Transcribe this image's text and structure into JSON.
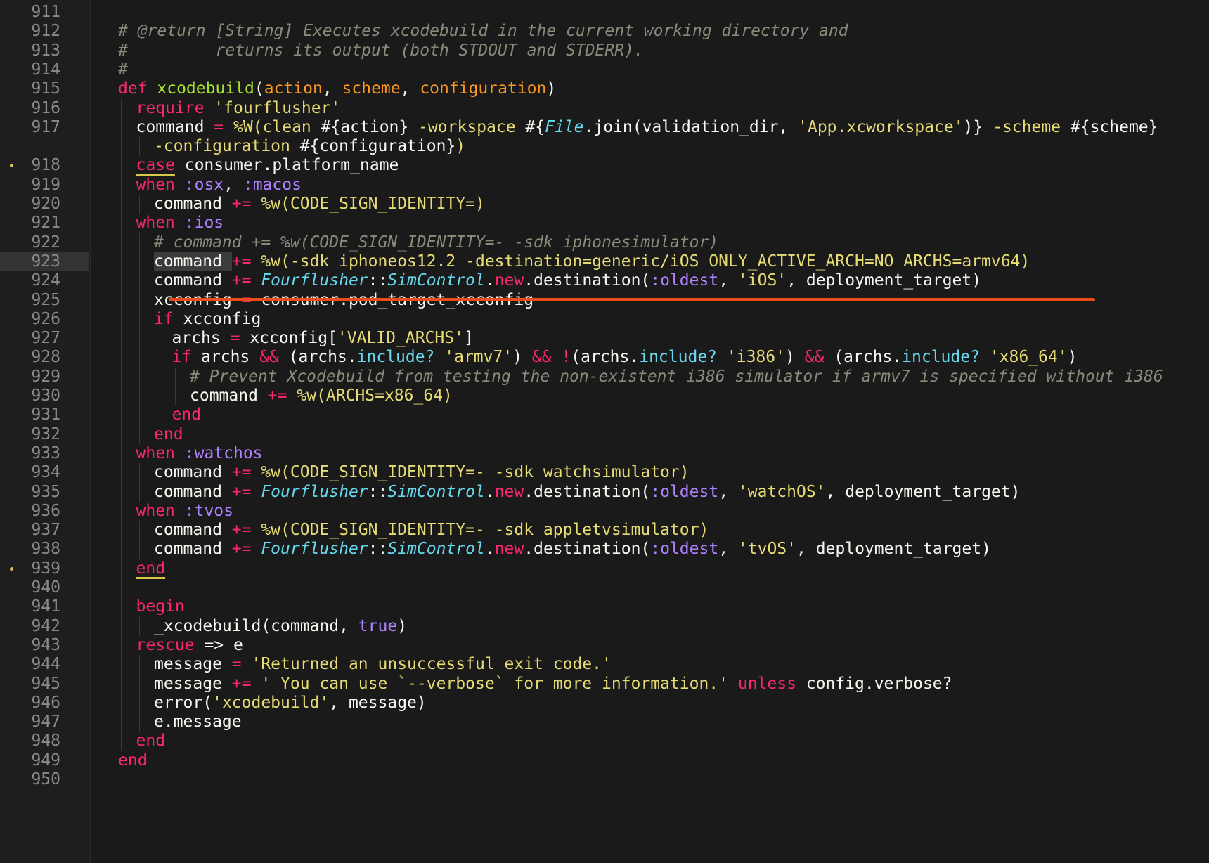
{
  "editor": {
    "active_line": "923",
    "lines": [
      {
        "n": "911",
        "indent": 0,
        "tokens": []
      },
      {
        "n": "912",
        "indent": 0,
        "tokens": [
          {
            "t": "cmt",
            "v": "# @return [String] Executes xcodebuild in the current working directory and"
          }
        ]
      },
      {
        "n": "913",
        "indent": 0,
        "tokens": [
          {
            "t": "cmt",
            "v": "#         returns its output (both STDOUT and STDERR)."
          }
        ]
      },
      {
        "n": "914",
        "indent": 0,
        "tokens": [
          {
            "t": "cmt",
            "v": "#"
          }
        ]
      },
      {
        "n": "915",
        "indent": 0,
        "tokens": [
          {
            "t": "kw",
            "v": "def "
          },
          {
            "t": "fn",
            "v": "xcodebuild"
          },
          {
            "t": "pln",
            "v": "("
          },
          {
            "t": "prm",
            "v": "action"
          },
          {
            "t": "pln",
            "v": ", "
          },
          {
            "t": "prm",
            "v": "scheme"
          },
          {
            "t": "pln",
            "v": ", "
          },
          {
            "t": "prm",
            "v": "configuration"
          },
          {
            "t": "pln",
            "v": ")"
          }
        ]
      },
      {
        "n": "916",
        "indent": 1,
        "tokens": [
          {
            "t": "kw",
            "v": "require "
          },
          {
            "t": "str",
            "v": "'fourflusher'"
          }
        ]
      },
      {
        "n": "917",
        "indent": 1,
        "tokens": [
          {
            "t": "pln",
            "v": "command "
          },
          {
            "t": "op",
            "v": "= "
          },
          {
            "t": "str",
            "v": "%W(clean "
          },
          {
            "t": "pln",
            "v": "#{action}"
          },
          {
            "t": "str",
            "v": " -workspace "
          },
          {
            "t": "pln",
            "v": "#{"
          },
          {
            "t": "cls",
            "v": "File"
          },
          {
            "t": "pln",
            "v": ".join(validation_dir, "
          },
          {
            "t": "str",
            "v": "'App.xcworkspace'"
          },
          {
            "t": "pln",
            "v": ")}"
          },
          {
            "t": "str",
            "v": " -scheme "
          },
          {
            "t": "pln",
            "v": "#{scheme}"
          }
        ]
      },
      {
        "n": "",
        "indent": 2,
        "tokens": [
          {
            "t": "str",
            "v": "-configuration "
          },
          {
            "t": "pln",
            "v": "#{configuration}"
          },
          {
            "t": "str",
            "v": ")"
          }
        ]
      },
      {
        "n": "918",
        "indent": 1,
        "dot": true,
        "tokens": [
          {
            "t": "ulkw",
            "v": "case"
          },
          {
            "t": "pln",
            "v": " consumer.platform_name"
          }
        ]
      },
      {
        "n": "919",
        "indent": 1,
        "tokens": [
          {
            "t": "kw",
            "v": "when "
          },
          {
            "t": "sym",
            "v": ":osx"
          },
          {
            "t": "pln",
            "v": ", "
          },
          {
            "t": "sym",
            "v": ":macos"
          }
        ]
      },
      {
        "n": "920",
        "indent": 2,
        "tokens": [
          {
            "t": "pln",
            "v": "command "
          },
          {
            "t": "op",
            "v": "+= "
          },
          {
            "t": "str",
            "v": "%w(CODE_SIGN_IDENTITY=)"
          }
        ]
      },
      {
        "n": "921",
        "indent": 1,
        "tokens": [
          {
            "t": "kw",
            "v": "when "
          },
          {
            "t": "sym",
            "v": ":ios"
          }
        ]
      },
      {
        "n": "922",
        "indent": 2,
        "tokens": [
          {
            "t": "cmt",
            "v": "# command += %w(CODE_SIGN_IDENTITY=- -sdk iphonesimulator)"
          }
        ]
      },
      {
        "n": "923",
        "indent": 2,
        "tokens": [
          {
            "t": "hlpln",
            "v": "command "
          },
          {
            "t": "op",
            "v": "+= "
          },
          {
            "t": "str",
            "v": "%w(-sdk iphoneos12.2 -destination=generic/iOS ONLY_ACTIVE_ARCH=NO ARCHS=armv64)"
          }
        ]
      },
      {
        "n": "924",
        "indent": 2,
        "tokens": [
          {
            "t": "pln",
            "v": "command "
          },
          {
            "t": "op",
            "v": "+= "
          },
          {
            "t": "cls",
            "v": "Fourflusher"
          },
          {
            "t": "pln",
            "v": "::"
          },
          {
            "t": "cls",
            "v": "SimControl"
          },
          {
            "t": "pln",
            "v": "."
          },
          {
            "t": "kw",
            "v": "new"
          },
          {
            "t": "pln",
            "v": ".destination("
          },
          {
            "t": "sym",
            "v": ":oldest"
          },
          {
            "t": "pln",
            "v": ", "
          },
          {
            "t": "str",
            "v": "'iOS'"
          },
          {
            "t": "pln",
            "v": ", deployment_target)"
          }
        ]
      },
      {
        "n": "925",
        "indent": 2,
        "tokens": [
          {
            "t": "pln",
            "v": "xcconfig "
          },
          {
            "t": "op",
            "v": "= "
          },
          {
            "t": "pln",
            "v": "consumer.pod_target_xcconfig"
          }
        ]
      },
      {
        "n": "926",
        "indent": 2,
        "tokens": [
          {
            "t": "kw",
            "v": "if "
          },
          {
            "t": "pln",
            "v": "xcconfig"
          }
        ]
      },
      {
        "n": "927",
        "indent": 3,
        "tokens": [
          {
            "t": "pln",
            "v": "archs "
          },
          {
            "t": "op",
            "v": "= "
          },
          {
            "t": "pln",
            "v": "xcconfig["
          },
          {
            "t": "str",
            "v": "'VALID_ARCHS'"
          },
          {
            "t": "pln",
            "v": "]"
          }
        ]
      },
      {
        "n": "928",
        "indent": 3,
        "tokens": [
          {
            "t": "kw",
            "v": "if "
          },
          {
            "t": "pln",
            "v": "archs "
          },
          {
            "t": "op",
            "v": "&& "
          },
          {
            "t": "pln",
            "v": "(archs."
          },
          {
            "t": "mth",
            "v": "include?"
          },
          {
            "t": "pln",
            "v": " "
          },
          {
            "t": "str",
            "v": "'armv7'"
          },
          {
            "t": "pln",
            "v": ") "
          },
          {
            "t": "op",
            "v": "&& !"
          },
          {
            "t": "pln",
            "v": "(archs."
          },
          {
            "t": "mth",
            "v": "include?"
          },
          {
            "t": "pln",
            "v": " "
          },
          {
            "t": "str",
            "v": "'i386'"
          },
          {
            "t": "pln",
            "v": ") "
          },
          {
            "t": "op",
            "v": "&& "
          },
          {
            "t": "pln",
            "v": "(archs."
          },
          {
            "t": "mth",
            "v": "include?"
          },
          {
            "t": "pln",
            "v": " "
          },
          {
            "t": "str",
            "v": "'x86_64'"
          },
          {
            "t": "pln",
            "v": ")"
          }
        ]
      },
      {
        "n": "929",
        "indent": 4,
        "tokens": [
          {
            "t": "cmt",
            "v": "# Prevent Xcodebuild from testing the non-existent i386 simulator if armv7 is specified without i386"
          }
        ]
      },
      {
        "n": "930",
        "indent": 4,
        "tokens": [
          {
            "t": "pln",
            "v": "command "
          },
          {
            "t": "op",
            "v": "+= "
          },
          {
            "t": "str",
            "v": "%w(ARCHS=x86_64)"
          }
        ]
      },
      {
        "n": "931",
        "indent": 3,
        "tokens": [
          {
            "t": "kw",
            "v": "end"
          }
        ]
      },
      {
        "n": "932",
        "indent": 2,
        "tokens": [
          {
            "t": "kw",
            "v": "end"
          }
        ]
      },
      {
        "n": "933",
        "indent": 1,
        "tokens": [
          {
            "t": "kw",
            "v": "when "
          },
          {
            "t": "sym",
            "v": ":watchos"
          }
        ]
      },
      {
        "n": "934",
        "indent": 2,
        "tokens": [
          {
            "t": "pln",
            "v": "command "
          },
          {
            "t": "op",
            "v": "+= "
          },
          {
            "t": "str",
            "v": "%w(CODE_SIGN_IDENTITY=- -sdk watchsimulator)"
          }
        ]
      },
      {
        "n": "935",
        "indent": 2,
        "tokens": [
          {
            "t": "pln",
            "v": "command "
          },
          {
            "t": "op",
            "v": "+= "
          },
          {
            "t": "cls",
            "v": "Fourflusher"
          },
          {
            "t": "pln",
            "v": "::"
          },
          {
            "t": "cls",
            "v": "SimControl"
          },
          {
            "t": "pln",
            "v": "."
          },
          {
            "t": "kw",
            "v": "new"
          },
          {
            "t": "pln",
            "v": ".destination("
          },
          {
            "t": "sym",
            "v": ":oldest"
          },
          {
            "t": "pln",
            "v": ", "
          },
          {
            "t": "str",
            "v": "'watchOS'"
          },
          {
            "t": "pln",
            "v": ", deployment_target)"
          }
        ]
      },
      {
        "n": "936",
        "indent": 1,
        "tokens": [
          {
            "t": "kw",
            "v": "when "
          },
          {
            "t": "sym",
            "v": ":tvos"
          }
        ]
      },
      {
        "n": "937",
        "indent": 2,
        "tokens": [
          {
            "t": "pln",
            "v": "command "
          },
          {
            "t": "op",
            "v": "+= "
          },
          {
            "t": "str",
            "v": "%w(CODE_SIGN_IDENTITY=- -sdk appletvsimulator)"
          }
        ]
      },
      {
        "n": "938",
        "indent": 2,
        "tokens": [
          {
            "t": "pln",
            "v": "command "
          },
          {
            "t": "op",
            "v": "+= "
          },
          {
            "t": "cls",
            "v": "Fourflusher"
          },
          {
            "t": "pln",
            "v": "::"
          },
          {
            "t": "cls",
            "v": "SimControl"
          },
          {
            "t": "pln",
            "v": "."
          },
          {
            "t": "kw",
            "v": "new"
          },
          {
            "t": "pln",
            "v": ".destination("
          },
          {
            "t": "sym",
            "v": ":oldest"
          },
          {
            "t": "pln",
            "v": ", "
          },
          {
            "t": "str",
            "v": "'tvOS'"
          },
          {
            "t": "pln",
            "v": ", deployment_target)"
          }
        ]
      },
      {
        "n": "939",
        "indent": 1,
        "dot": true,
        "tokens": [
          {
            "t": "ulkw",
            "v": "end"
          }
        ]
      },
      {
        "n": "940",
        "indent": 0,
        "tokens": []
      },
      {
        "n": "941",
        "indent": 1,
        "tokens": [
          {
            "t": "kw",
            "v": "begin"
          }
        ]
      },
      {
        "n": "942",
        "indent": 2,
        "tokens": [
          {
            "t": "pln",
            "v": "_xcodebuild(command, "
          },
          {
            "t": "sym",
            "v": "true"
          },
          {
            "t": "pln",
            "v": ")"
          }
        ]
      },
      {
        "n": "943",
        "indent": 1,
        "tokens": [
          {
            "t": "kw",
            "v": "rescue "
          },
          {
            "t": "pln",
            "v": "=> e"
          }
        ]
      },
      {
        "n": "944",
        "indent": 2,
        "tokens": [
          {
            "t": "pln",
            "v": "message "
          },
          {
            "t": "op",
            "v": "= "
          },
          {
            "t": "str",
            "v": "'Returned an unsuccessful exit code.'"
          }
        ]
      },
      {
        "n": "945",
        "indent": 2,
        "tokens": [
          {
            "t": "pln",
            "v": "message "
          },
          {
            "t": "op",
            "v": "+= "
          },
          {
            "t": "str",
            "v": "' You can use `--verbose` for more information.'"
          },
          {
            "t": "kw",
            "v": " unless "
          },
          {
            "t": "pln",
            "v": "config.verbose?"
          }
        ]
      },
      {
        "n": "946",
        "indent": 2,
        "tokens": [
          {
            "t": "pln",
            "v": "error("
          },
          {
            "t": "str",
            "v": "'xcodebuild'"
          },
          {
            "t": "pln",
            "v": ", message)"
          }
        ]
      },
      {
        "n": "947",
        "indent": 2,
        "tokens": [
          {
            "t": "pln",
            "v": "e.message"
          }
        ]
      },
      {
        "n": "948",
        "indent": 1,
        "tokens": [
          {
            "t": "kw",
            "v": "end"
          }
        ]
      },
      {
        "n": "949",
        "indent": 0,
        "tokens": [
          {
            "t": "kw",
            "v": "end"
          }
        ]
      },
      {
        "n": "950",
        "indent": 0,
        "tokens": []
      }
    ]
  },
  "colors": {
    "background": "#1a1a1a",
    "comment": "#8a8a7a",
    "keyword": "#f92672",
    "function": "#a6e22e",
    "parameter": "#fd971f",
    "string": "#e6db74",
    "symbol": "#ae81ff",
    "class": "#66d9ef",
    "annotation_underline": "#ee4a1a"
  }
}
